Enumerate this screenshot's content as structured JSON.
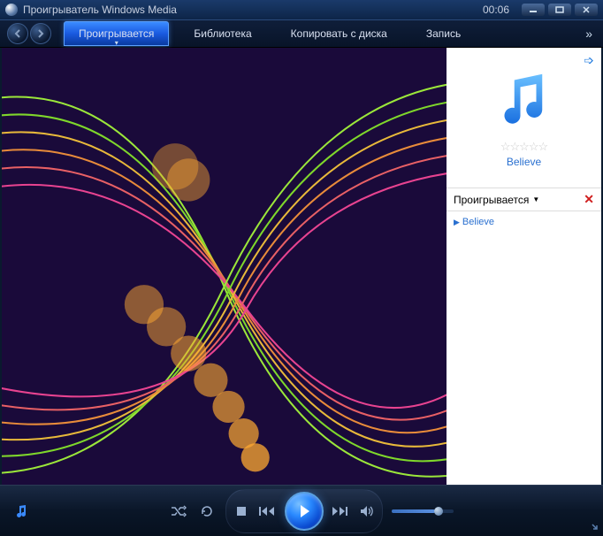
{
  "titlebar": {
    "title": "Проигрыватель Windows Media",
    "time": "00:06"
  },
  "nav": {
    "tabs": [
      {
        "label": "Проигрывается",
        "active": true
      },
      {
        "label": "Библиотека",
        "active": false
      },
      {
        "label": "Копировать с диска",
        "active": false
      },
      {
        "label": "Запись",
        "active": false
      }
    ]
  },
  "sidebar": {
    "track_title": "Believe",
    "rating_stars": "☆☆☆☆☆",
    "playlist_header": "Проигрывается",
    "items": [
      {
        "label": "Believe"
      }
    ]
  },
  "controls": {
    "volume_percent": 70
  }
}
